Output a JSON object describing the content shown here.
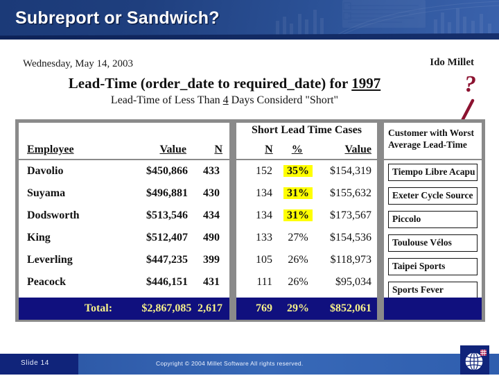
{
  "slide": {
    "title": "Subreport or Sandwich?",
    "accent_navy": "#10247a",
    "highlight_color": "#ffff00",
    "annotation_color": "#8c1230"
  },
  "report": {
    "date": "Wednesday, May 14, 2003",
    "author": "Ido Millet",
    "title_prefix": "Lead-Time (order_date to required_date) for ",
    "title_year": "1997",
    "subtitle_prefix": "Lead-Time of Less Than ",
    "subtitle_days": "4",
    "subtitle_suffix": " Days Considerd \"Short\""
  },
  "annotation": {
    "mark": "?"
  },
  "table": {
    "group_headers": {
      "short_lead_time_cases": "Short Lead Time Cases",
      "customer_worst_line1": "Customer with Worst",
      "customer_worst_line2": "Average Lead-Time"
    },
    "columns": {
      "employee": "Employee",
      "value": "Value",
      "n": "N",
      "short_n": "N",
      "short_pct": "%",
      "short_value": "Value"
    },
    "rows": [
      {
        "employee": "Davolio",
        "value": "$450,866",
        "n": "433",
        "short_n": "152",
        "short_pct": "35%",
        "short_value": "$154,319",
        "customer": "Tiempo Libre Acapu",
        "highlight": true
      },
      {
        "employee": "Suyama",
        "value": "$496,881",
        "n": "430",
        "short_n": "134",
        "short_pct": "31%",
        "short_value": "$155,632",
        "customer": "Exeter Cycle Source",
        "highlight": true
      },
      {
        "employee": "Dodsworth",
        "value": "$513,546",
        "n": "434",
        "short_n": "134",
        "short_pct": "31%",
        "short_value": "$173,567",
        "customer": "Piccolo",
        "highlight": true
      },
      {
        "employee": "King",
        "value": "$512,407",
        "n": "490",
        "short_n": "133",
        "short_pct": "27%",
        "short_value": "$154,536",
        "customer": "Toulouse Vélos",
        "highlight": false
      },
      {
        "employee": "Leverling",
        "value": "$447,235",
        "n": "399",
        "short_n": "105",
        "short_pct": "26%",
        "short_value": "$118,973",
        "customer": "Taipei Sports",
        "highlight": false
      },
      {
        "employee": "Peacock",
        "value": "$446,151",
        "n": "431",
        "short_n": "111",
        "short_pct": "26%",
        "short_value": "$95,034",
        "customer": "Sports Fever",
        "highlight": false
      }
    ],
    "total": {
      "label": "Total:",
      "value": "$2,867,085",
      "n": "2,617",
      "short_n": "769",
      "short_pct": "29%",
      "short_value": "$852,061"
    }
  },
  "footer": {
    "slide_label": "Slide 14",
    "copyright": "Copyright © 2004 Millet Software All rights reserved."
  },
  "chart_data": {
    "type": "table",
    "title": "Lead-Time (order_date to required_date) for 1997",
    "subtitle": "Lead-Time of Less Than 4 Days Considerd \"Short\"",
    "columns": [
      "Employee",
      "Value",
      "N",
      "Short N",
      "Short %",
      "Short Value",
      "Customer with Worst Average Lead-Time"
    ],
    "rows": [
      [
        "Davolio",
        450866,
        433,
        152,
        35,
        154319,
        "Tiempo Libre Acapu"
      ],
      [
        "Suyama",
        496881,
        430,
        134,
        31,
        155632,
        "Exeter Cycle Source"
      ],
      [
        "Dodsworth",
        513546,
        434,
        134,
        31,
        173567,
        "Piccolo"
      ],
      [
        "King",
        512407,
        490,
        133,
        27,
        154536,
        "Toulouse Vélos"
      ],
      [
        "Leverling",
        447235,
        399,
        105,
        26,
        118973,
        "Taipei Sports"
      ],
      [
        "Peacock",
        446151,
        431,
        111,
        26,
        95034,
        "Sports Fever"
      ]
    ],
    "total": [
      "Total:",
      2867085,
      2617,
      769,
      29,
      852061,
      ""
    ]
  }
}
